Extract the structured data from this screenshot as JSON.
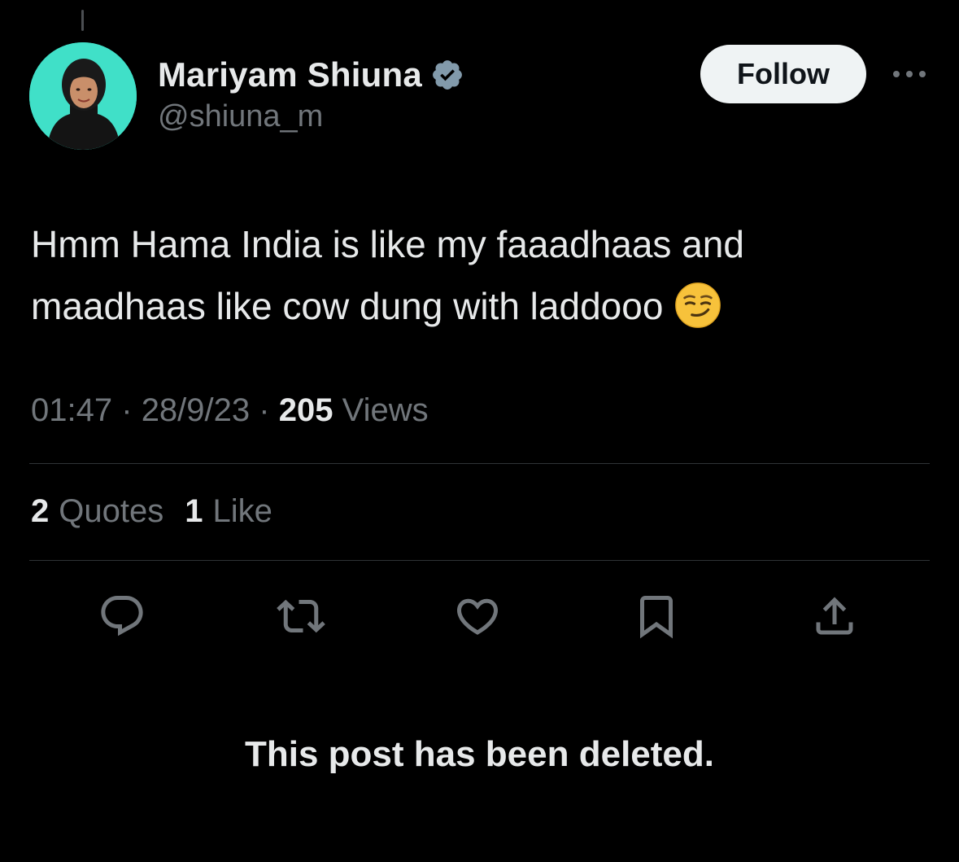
{
  "tweet": {
    "author": {
      "display_name": "Mariyam Shiuna",
      "handle": "@shiuna_m",
      "verified_icon": "verified-badge-icon",
      "avatar_bg": "#40e0c8"
    },
    "follow_label": "Follow",
    "more_icon": "more-dots-icon",
    "text_line_1": "Hmm Hama India is like my faaadhaas and",
    "text_line_2": "maadhaas like cow dung with laddooo",
    "emoji": "smirking-face-emoji",
    "time": "01:47",
    "date": "28/9/23",
    "separator": "·",
    "views_count": "205",
    "views_label": "Views",
    "stats": {
      "quotes_count": "2",
      "quotes_label": "Quotes",
      "likes_count": "1",
      "likes_label": "Like"
    },
    "actions": [
      "reply-icon",
      "retweet-icon",
      "like-icon",
      "bookmark-icon",
      "share-icon"
    ],
    "deleted_notice": "This post has been deleted."
  },
  "colors": {
    "background": "#000000",
    "primary_text": "#e7e9ea",
    "secondary_text": "#71767b",
    "divider": "#2f3336",
    "verified_badge": "#829aab",
    "follow_bg": "#eff3f4"
  }
}
